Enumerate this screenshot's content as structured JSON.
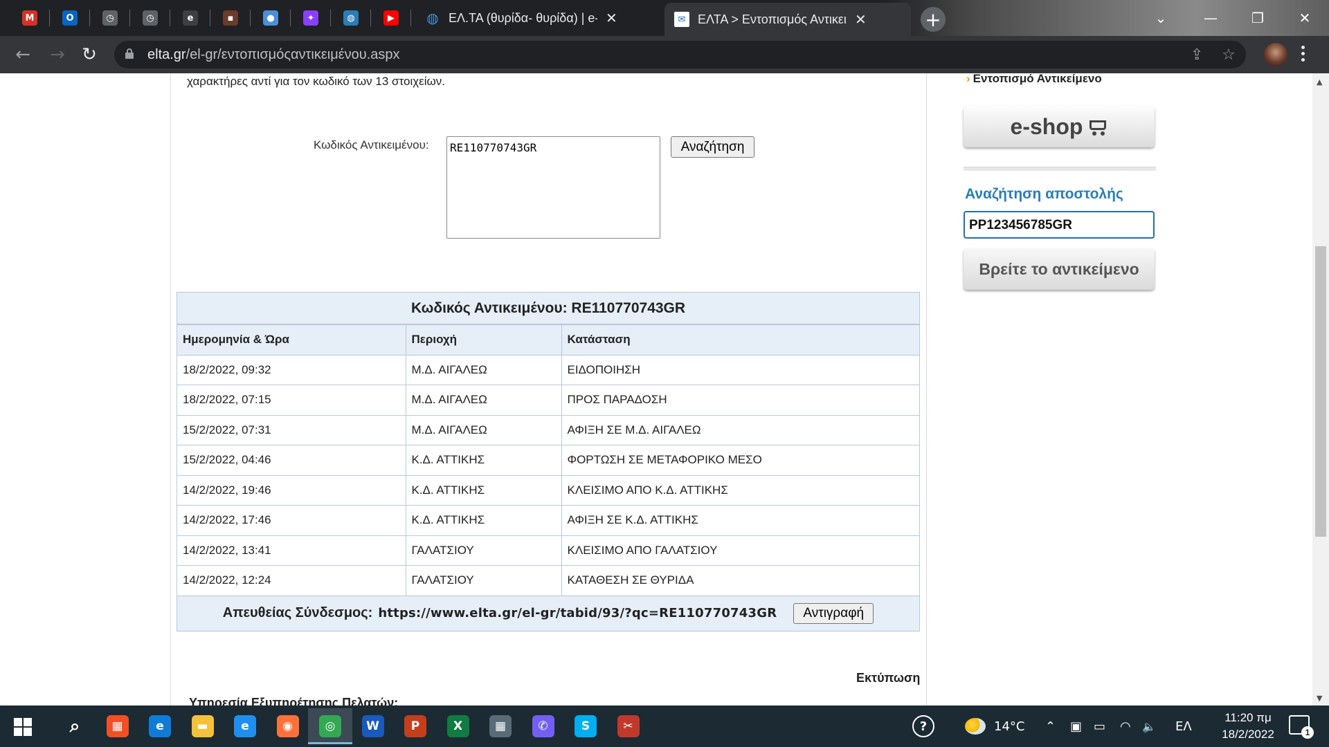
{
  "browser": {
    "pinned_tabs": [
      {
        "icon": "gmail-icon",
        "glyph": "M",
        "color": "#d93025"
      },
      {
        "icon": "outlook-icon",
        "glyph": "O",
        "color": "#0a64c2"
      },
      {
        "icon": "clock-globe-icon",
        "glyph": "◷",
        "color": "#5f6368"
      },
      {
        "icon": "clock-globe-icon",
        "glyph": "◷",
        "color": "#5f6368"
      },
      {
        "icon": "eclass-icon",
        "glyph": "e",
        "color": "#3c4043"
      },
      {
        "icon": "robot-icon",
        "glyph": "▪",
        "color": "#6b3b2b"
      },
      {
        "icon": "circle-app-icon",
        "glyph": "●",
        "color": "#4a90d9"
      },
      {
        "icon": "messenger-icon",
        "glyph": "✦",
        "color": "#8a3ffc"
      },
      {
        "icon": "globe-icon",
        "glyph": "◍",
        "color": "#2a7db5"
      },
      {
        "icon": "youtube-icon",
        "glyph": "▶",
        "color": "#ff0000"
      }
    ],
    "tabs": [
      {
        "title": "ΕΛ.ΤΑ (θυρίδα- θυρίδα) | e-steki",
        "icon": "globe-icon"
      },
      {
        "title": "ΕΛΤΑ > Εντοπισμός Αντικειμένου",
        "icon": "elta-icon"
      }
    ],
    "new_tab_symbol": "+",
    "window_controls": {
      "chevron": "⌄",
      "minimize": "—",
      "restore": "❐",
      "close": "✕"
    },
    "nav": {
      "back": "←",
      "forward": "→",
      "reload": "↻"
    },
    "url_host": "elta.gr",
    "url_path": "/el-gr/εντοπισμόςαντικειμένου.aspx",
    "omni_icons": {
      "share": "⇪",
      "star": "☆"
    }
  },
  "page": {
    "intro_text": "χαρακτήρες αντί για τον κωδικό των 13 στοιχείων.",
    "code_label": "Κωδικός Αντικειμένου:",
    "code_value": "RE110770743GR",
    "search_button": "Αναζήτηση",
    "result_header_label": "Κωδικός Αντικειμένου:",
    "result_header_code": "RE110770743GR",
    "columns": [
      "Ημερομηνία & Ώρα",
      "Περιοχή",
      "Κατάσταση"
    ],
    "rows": [
      [
        "18/2/2022, 09:32",
        "Μ.Δ. ΑΙΓΑΛΕΩ",
        "ΕΙΔΟΠΟΙΗΣΗ"
      ],
      [
        "18/2/2022, 07:15",
        "Μ.Δ. ΑΙΓΑΛΕΩ",
        "ΠΡΟΣ ΠΑΡΑΔΟΣΗ"
      ],
      [
        "15/2/2022, 07:31",
        "Μ.Δ. ΑΙΓΑΛΕΩ",
        "ΑΦΙΞΗ ΣΕ Μ.Δ. ΑΙΓΑΛΕΩ"
      ],
      [
        "15/2/2022, 04:46",
        "Κ.Δ. ΑΤΤΙΚΗΣ",
        "ΦΟΡΤΩΣΗ ΣΕ ΜΕΤΑΦΟΡΙΚΟ ΜΕΣΟ"
      ],
      [
        "14/2/2022, 19:46",
        "Κ.Δ. ΑΤΤΙΚΗΣ",
        "ΚΛΕΙΣΙΜΟ ΑΠΟ Κ.Δ. ΑΤΤΙΚΗΣ"
      ],
      [
        "14/2/2022, 17:46",
        "Κ.Δ. ΑΤΤΙΚΗΣ",
        "ΑΦΙΞΗ ΣΕ Κ.Δ. ΑΤΤΙΚΗΣ"
      ],
      [
        "14/2/2022, 13:41",
        "ΓΑΛΑΤΣΙΟΥ",
        "ΚΛΕΙΣΙΜΟ ΑΠΟ ΓΑΛΑΤΣΙΟΥ"
      ],
      [
        "14/2/2022, 12:24",
        "ΓΑΛΑΤΣΙΟΥ",
        "ΚΑΤΑΘΕΣΗ ΣΕ ΘΥΡΙΔΑ"
      ]
    ],
    "direct_link_label": "Απευθείας Σύνδεσμος:",
    "direct_link_url": "https://www.elta.gr/el-gr/tabid/93/?qc=RE110770743GR",
    "copy_button": "Αντιγραφή",
    "print_link": "Εκτύπωση",
    "support_heading": "Υπηρεσία Εξυπηρέτησης Πελατών:"
  },
  "sidebar": {
    "track_link": "Εντοπισμό Αντικείμενο",
    "track_arrow": "›",
    "eshop_label": "e-shop",
    "search_title": "Αναζήτηση αποστολής",
    "search_value": "PP123456785GR",
    "find_button": "Βρείτε το αντικείμενο"
  },
  "taskbar": {
    "apps": [
      {
        "name": "search-icon",
        "glyph": "⌕",
        "color": "transparent"
      },
      {
        "name": "microsoft-store-icon",
        "glyph": "▦",
        "color": "#f25022"
      },
      {
        "name": "edge-icon",
        "glyph": "e",
        "color": "#0f7bd8"
      },
      {
        "name": "file-explorer-icon",
        "glyph": "▬",
        "color": "#f4c13a"
      },
      {
        "name": "internet-explorer-icon",
        "glyph": "e",
        "color": "#1e8ff0"
      },
      {
        "name": "firefox-icon",
        "glyph": "◉",
        "color": "#ff7139"
      },
      {
        "name": "chrome-icon",
        "glyph": "◎",
        "color": "#34a853"
      },
      {
        "name": "word-icon",
        "glyph": "W",
        "color": "#185abd"
      },
      {
        "name": "powerpoint-icon",
        "glyph": "P",
        "color": "#c43e1c"
      },
      {
        "name": "excel-icon",
        "glyph": "X",
        "color": "#107c41"
      },
      {
        "name": "calculator-icon",
        "glyph": "▦",
        "color": "#5a6b78"
      },
      {
        "name": "viber-icon",
        "glyph": "✆",
        "color": "#7360f2"
      },
      {
        "name": "skype-icon",
        "glyph": "S",
        "color": "#00aff0"
      },
      {
        "name": "snipping-tool-icon",
        "glyph": "✂",
        "color": "#c0392b"
      }
    ],
    "temperature": "14°C",
    "language": "ΕΛ",
    "time": "11:20 πμ",
    "date": "18/2/2022",
    "notification_count": "1",
    "tray_icons": {
      "help": "?",
      "chevron": "⌃",
      "meet": "▣",
      "battery": "▭",
      "wifi": "◠",
      "volume": "🔈"
    }
  }
}
